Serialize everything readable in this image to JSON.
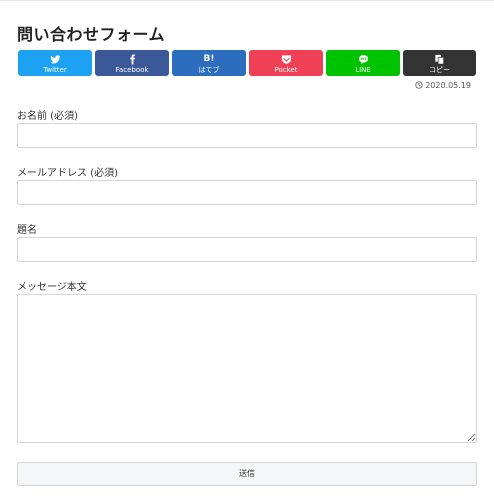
{
  "page": {
    "title": "問い合わせフォーム"
  },
  "share": {
    "twitter": {
      "label": "Twitter",
      "color": "#1da1f2"
    },
    "facebook": {
      "label": "Facebook",
      "color": "#3b5998"
    },
    "hatena": {
      "label": "はてブ",
      "icon_text": "B!",
      "color": "#2c6ebd"
    },
    "pocket": {
      "label": "Pocket",
      "color": "#ef4056"
    },
    "line": {
      "label": "LINE",
      "color": "#00c300"
    },
    "copy": {
      "label": "コピー",
      "color": "#333333"
    }
  },
  "post": {
    "date": "2020.05.19"
  },
  "form": {
    "name_label": "お名前 (必須)",
    "name_value": "",
    "email_label": "メールアドレス (必須)",
    "email_value": "",
    "subject_label": "題名",
    "subject_value": "",
    "message_label": "メッセージ本文",
    "message_value": "",
    "submit_label": "送信"
  }
}
